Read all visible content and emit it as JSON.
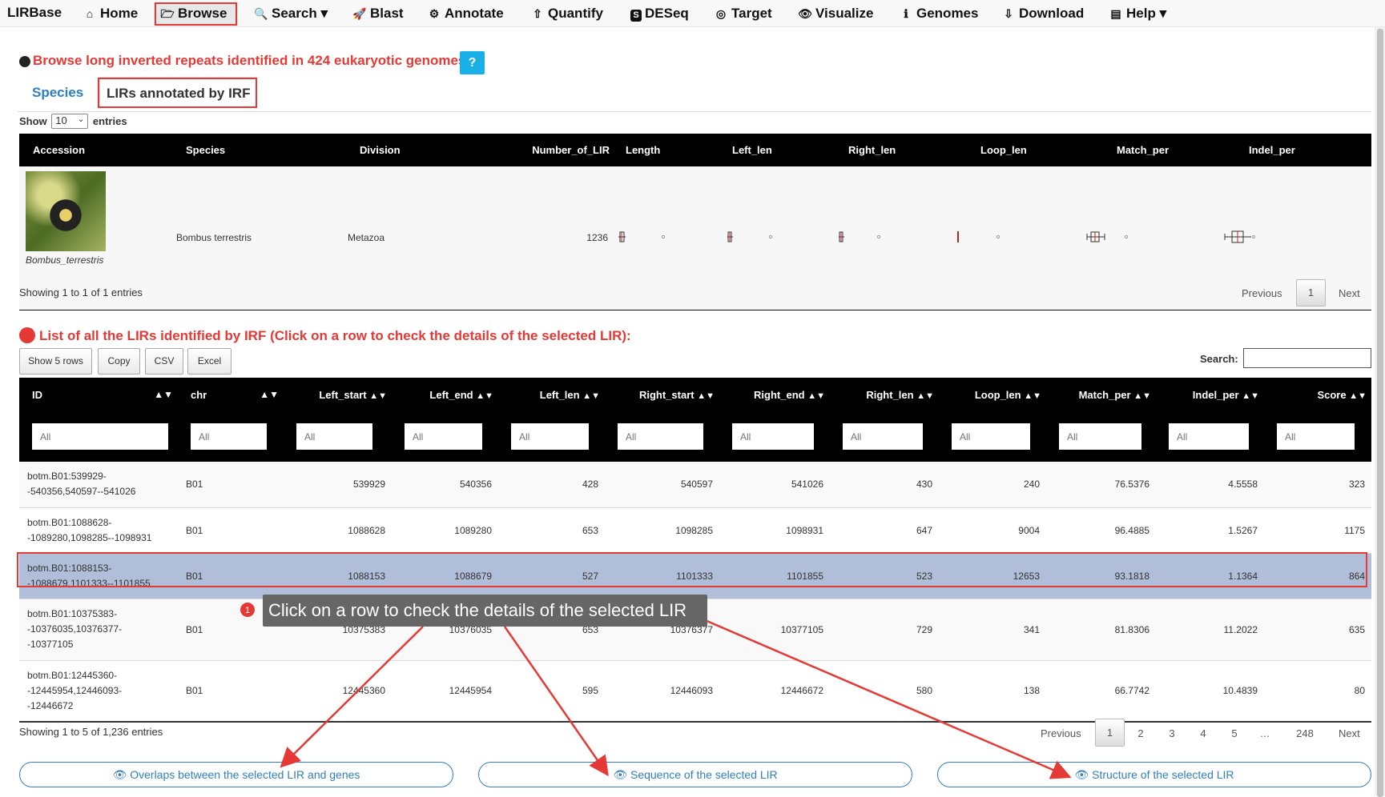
{
  "nav": {
    "brand": "LIRBase",
    "items": [
      {
        "label": "Home",
        "icon": "home-icon",
        "glyph": "⌂"
      },
      {
        "label": "Browse",
        "icon": "folder-open-icon",
        "glyph": "🗁"
      },
      {
        "label": "Search",
        "icon": "search-icon",
        "glyph": "🔍"
      },
      {
        "label": "Blast",
        "icon": "rocket-icon",
        "glyph": "🚀"
      },
      {
        "label": "Annotate",
        "icon": "cogs-icon",
        "glyph": "⚙"
      },
      {
        "label": "Quantify",
        "icon": "upload-icon",
        "glyph": "⇧"
      },
      {
        "label": "DESeq",
        "icon": "deseq-icon",
        "glyph": "S"
      },
      {
        "label": "Target",
        "icon": "target-icon",
        "glyph": "◎"
      },
      {
        "label": "Visualize",
        "icon": "eye-icon",
        "glyph": "👁"
      },
      {
        "label": "Genomes",
        "icon": "info-icon",
        "glyph": "ℹ"
      },
      {
        "label": "Download",
        "icon": "download-icon",
        "glyph": "⇩"
      },
      {
        "label": "Help",
        "icon": "book-icon",
        "glyph": "▤"
      }
    ],
    "caret": "▾"
  },
  "browse": {
    "title": "Browse long inverted repeats identified in 424 eukaryotic genomes",
    "help": "?",
    "tabs": [
      "Species",
      "LIRs annotated by IRF"
    ]
  },
  "length_menu": {
    "show": "Show",
    "value": "10",
    "entries": "entries"
  },
  "species_table": {
    "headers": [
      "Accession",
      "Species",
      "Division",
      "Number_of_LIR",
      "Length",
      "Left_len",
      "Right_len",
      "Loop_len",
      "Match_per",
      "Indel_per"
    ],
    "row": {
      "caption": "Bombus_terrestris",
      "species": "Bombus terrestris",
      "division": "Metazoa",
      "number_of_lir": "1236"
    },
    "info": "Showing 1 to 1 of 1 entries",
    "pager": {
      "previous": "Previous",
      "current": "1",
      "next": "Next"
    }
  },
  "lir_list": {
    "title": "List of all the LIRs identified by IRF (Click on a row to check the details of the selected LIR):",
    "buttons": [
      "Show 5 rows",
      "Copy",
      "CSV",
      "Excel"
    ],
    "search_label": "Search:",
    "headers": [
      "ID",
      "chr",
      "Left_start",
      "Left_end",
      "Left_len",
      "Right_start",
      "Right_end",
      "Right_len",
      "Loop_len",
      "Match_per",
      "Indel_per",
      "Score"
    ],
    "filter_placeholder": "All",
    "rows": [
      {
        "id1": "botm.B01:539929-",
        "id2": "-540356,540597--541026",
        "id3": "",
        "chr": "B01",
        "left_start": "539929",
        "left_end": "540356",
        "left_len": "428",
        "right_start": "540597",
        "right_end": "541026",
        "right_len": "430",
        "loop_len": "240",
        "match_per": "76.5376",
        "indel_per": "4.5558",
        "score": "323"
      },
      {
        "id1": "botm.B01:1088628-",
        "id2": "-1089280,1098285--1098931",
        "id3": "",
        "chr": "B01",
        "left_start": "1088628",
        "left_end": "1089280",
        "left_len": "653",
        "right_start": "1098285",
        "right_end": "1098931",
        "right_len": "647",
        "loop_len": "9004",
        "match_per": "96.4885",
        "indel_per": "1.5267",
        "score": "1175"
      },
      {
        "id1": "botm.B01:1088153-",
        "id2": "-1088679,1101333--1101855",
        "id3": "",
        "chr": "B01",
        "left_start": "1088153",
        "left_end": "1088679",
        "left_len": "527",
        "right_start": "1101333",
        "right_end": "1101855",
        "right_len": "523",
        "loop_len": "12653",
        "match_per": "93.1818",
        "indel_per": "1.1364",
        "score": "864"
      },
      {
        "id1": "botm.B01:10375383-",
        "id2": "-10376035,10376377-",
        "id3": "-10377105",
        "chr": "B01",
        "left_start": "10375383",
        "left_end": "10376035",
        "left_len": "653",
        "right_start": "10376377",
        "right_end": "10377105",
        "right_len": "729",
        "loop_len": "341",
        "match_per": "81.8306",
        "indel_per": "11.2022",
        "score": "635"
      },
      {
        "id1": "botm.B01:12445360-",
        "id2": "-12445954,12446093-",
        "id3": "-12446672",
        "chr": "B01",
        "left_start": "12445360",
        "left_end": "12445954",
        "left_len": "595",
        "right_start": "12446093",
        "right_end": "12446672",
        "right_len": "580",
        "loop_len": "138",
        "match_per": "66.7742",
        "indel_per": "10.4839",
        "score": "80"
      }
    ],
    "info": "Showing 1 to 5 of 1,236 entries",
    "pager": {
      "previous": "Previous",
      "pages": [
        "1",
        "2",
        "3",
        "4",
        "5",
        "…",
        "248"
      ],
      "next": "Next"
    }
  },
  "tooltip": {
    "badge": "1",
    "text": "Click on a row to check the details of the selected LIR"
  },
  "detail_buttons": [
    "Overlaps between the selected LIR and genes",
    "Sequence of the selected LIR",
    "Structure of the selected LIR"
  ],
  "colors": {
    "accent_red": "#e53935",
    "link_blue": "#2f7fbf",
    "selected_row": "#b0bed9",
    "help_blue": "#18b0e6"
  }
}
